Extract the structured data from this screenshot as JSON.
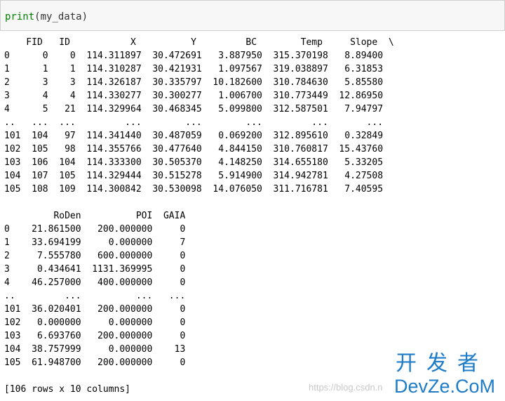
{
  "input_cell": {
    "fn": "print",
    "open": "(",
    "arg": "my_data",
    "close": ")"
  },
  "output_lines": [
    "    FID   ID           X          Y         BC        Temp     Slope  \\",
    "0      0    0  114.311897  30.472691   3.887950  315.370198   8.89400",
    "1      1    1  114.310287  30.421931   1.097567  319.038897   6.31853",
    "2      3    3  114.326187  30.335797  10.182600  310.784630   5.85580",
    "3      4    4  114.330277  30.300277   1.006700  310.773449  12.86950",
    "4      5   21  114.329964  30.468345   5.099800  312.587501   7.94797",
    "..   ...  ...         ...        ...        ...         ...       ...",
    "101  104   97  114.341440  30.487059   0.069200  312.895610   0.32849",
    "102  105   98  114.355766  30.477640   4.844150  310.760817  15.43760",
    "103  106  104  114.333300  30.505370   4.148250  314.655180   5.33205",
    "104  107  105  114.329444  30.515278   5.914900  314.942781   4.27508",
    "105  108  109  114.300842  30.530098  14.076050  311.716781   7.40595",
    "",
    "         RoDen          POI  GAIA",
    "0    21.861500   200.000000     0",
    "1    33.694199     0.000000     7",
    "2     7.555780   600.000000     0",
    "3     0.434641  1131.369995     0",
    "4    46.257000   400.000000     0",
    "..         ...          ...   ...",
    "101  36.020401   200.000000     0",
    "102   0.000000     0.000000     0",
    "103   6.693760   200.000000     0",
    "104  38.757999     0.000000    13",
    "105  61.948700   200.000000     0",
    "",
    "[106 rows x 10 columns]"
  ],
  "watermark": {
    "url": "https://blog.csdn.n",
    "logo_cn": "开发者",
    "logo_en": "DevZe.CoM"
  },
  "colors": {
    "input_bg": "#f7f7f7",
    "input_border": "#cfcfcf",
    "keyword_green": "#008000",
    "watermark_blue": "#1e7bc8"
  }
}
